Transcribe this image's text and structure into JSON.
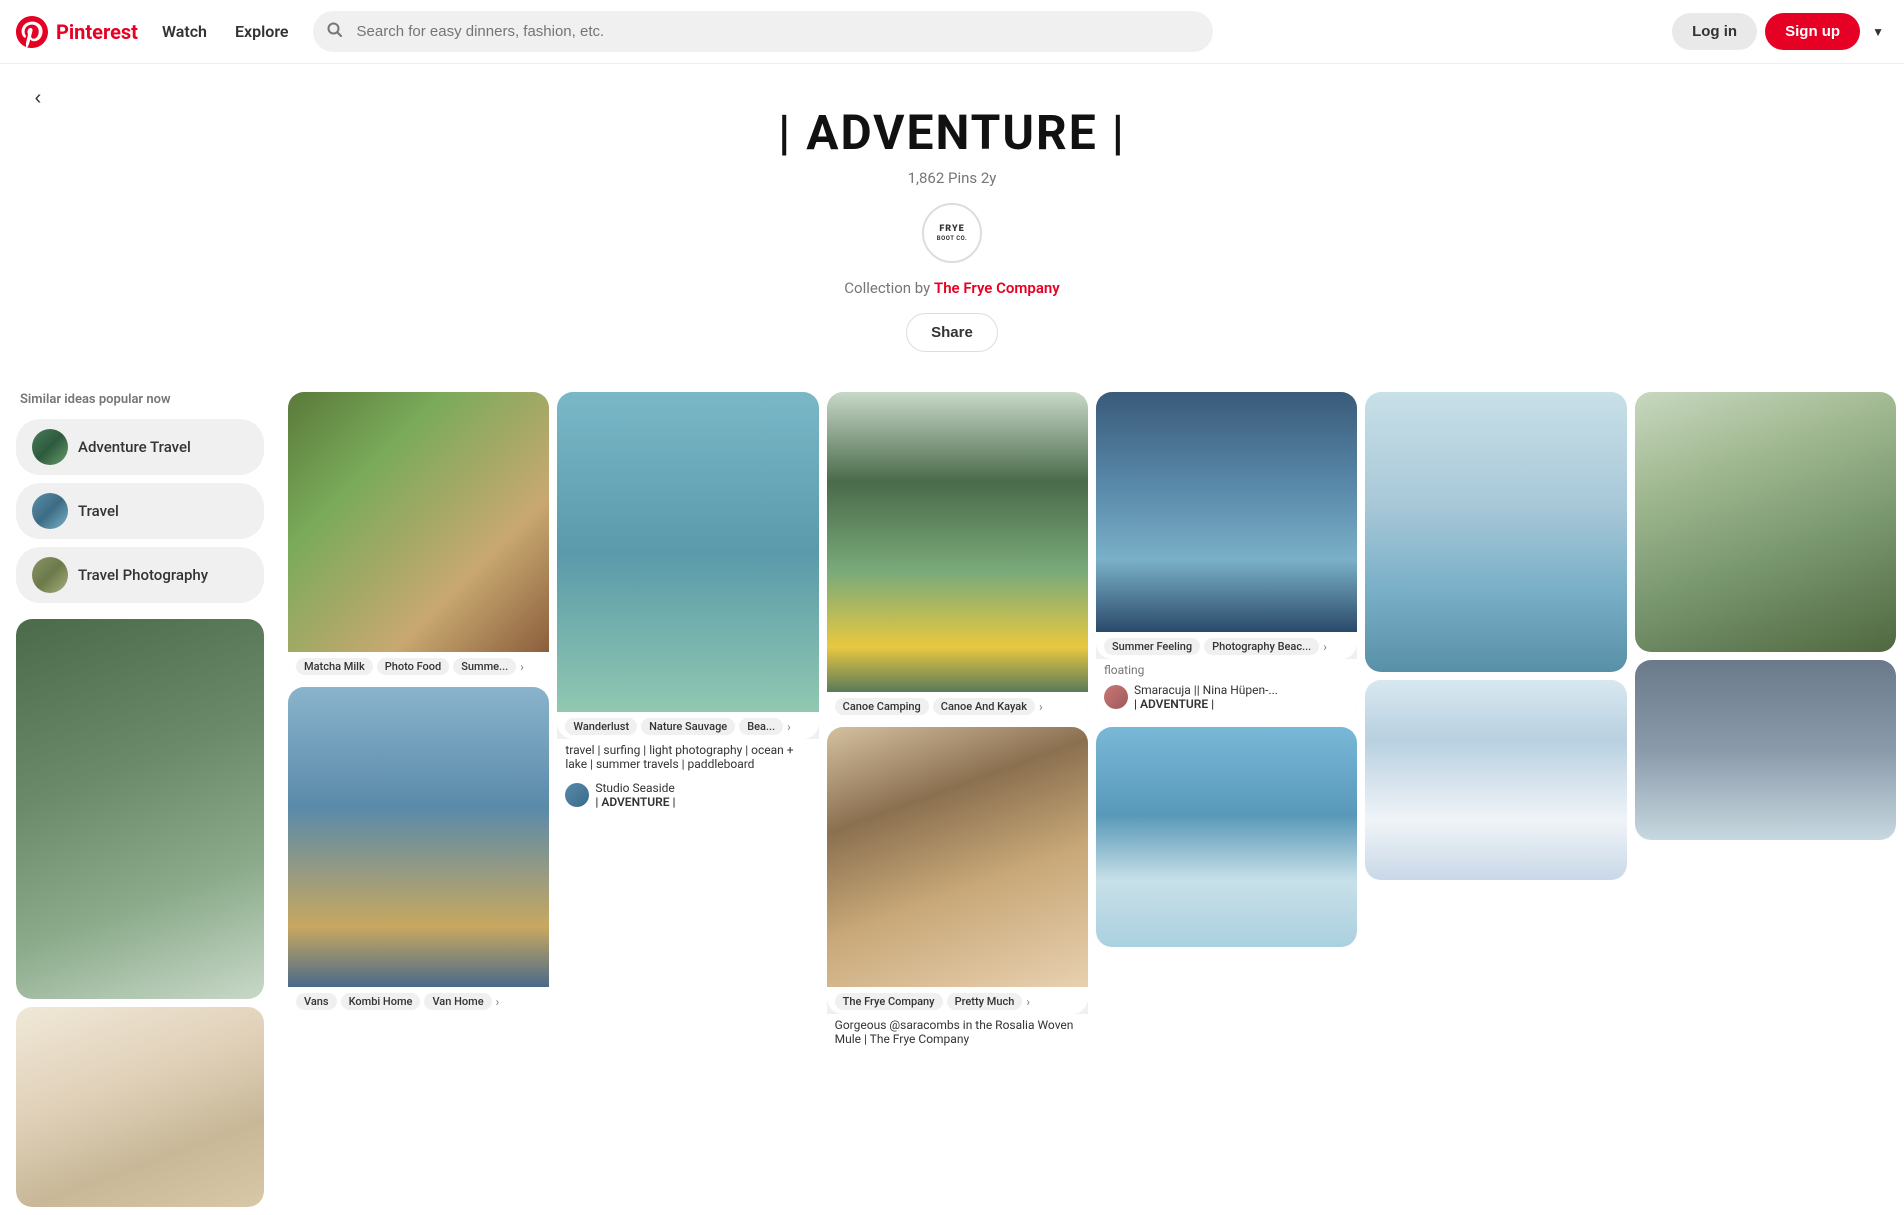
{
  "header": {
    "logo_text": "Pinterest",
    "nav": {
      "watch": "Watch",
      "explore": "Explore"
    },
    "search_placeholder": "Search for easy dinners, fashion, etc.",
    "login_label": "Log in",
    "signup_label": "Sign up"
  },
  "board": {
    "title": "| ADVENTURE |",
    "pins_count": "1,862 Pins",
    "age": "2y",
    "collection_by": "Collection by",
    "owner": "The Frye Company",
    "share_label": "Share",
    "frye_logo_line1": "FRYE",
    "frye_logo_line2": "BOOT CO."
  },
  "sidebar": {
    "similar_ideas_title": "Similar ideas popular now",
    "chips": [
      {
        "label": "Adventure Travel",
        "id": "adventure-travel"
      },
      {
        "label": "Travel",
        "id": "travel"
      },
      {
        "label": "Travel Photography",
        "id": "travel-photography"
      }
    ]
  },
  "pins": [
    {
      "id": "pin-food",
      "tags": [
        "Matcha Milk",
        "Photo Food",
        "Summe..."
      ],
      "has_more": true
    },
    {
      "id": "pin-van",
      "tags": [
        "Vans",
        "Kombi Home",
        "Van Home"
      ],
      "has_more": true
    },
    {
      "id": "pin-water",
      "tags": [
        "Wanderlust",
        "Nature Sauvage",
        "Bea..."
      ],
      "has_more": true,
      "description": "travel | surfing | light photography | ocean + lake | summer travels | paddleboard",
      "author": "Studio Seaside",
      "board": "| ADVENTURE |"
    },
    {
      "id": "pin-canoe",
      "tags": [
        "Canoe Camping",
        "Canoe And Kayak"
      ],
      "has_more": true
    },
    {
      "id": "pin-cactus",
      "attribution_tags": [
        "The Frye Company",
        "Pretty Much"
      ],
      "has_more": true,
      "description": "Gorgeous @saracombs in the Rosalia Woven Mule | The Frye Company"
    },
    {
      "id": "pin-boat",
      "tags": [
        "Summer Feeling",
        "Photography Beac..."
      ],
      "has_more": true,
      "bottom_text": "floating",
      "author": "Smaracuja || Nina Hüpen-...",
      "board": "| ADVENTURE |"
    },
    {
      "id": "pin-rock",
      "tags": []
    },
    {
      "id": "pin-glacier",
      "tags": []
    },
    {
      "id": "pin-sky",
      "tags": []
    },
    {
      "id": "pin-tent",
      "tags": []
    }
  ]
}
